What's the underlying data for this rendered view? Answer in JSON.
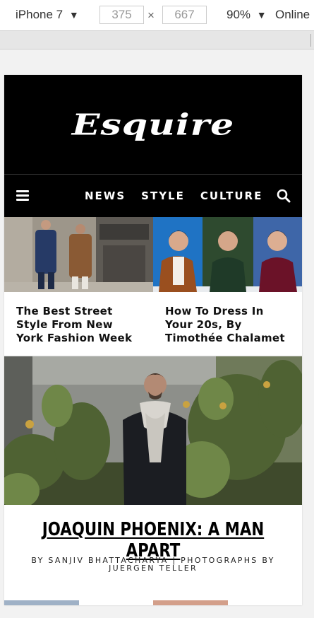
{
  "devtools": {
    "device": "iPhone 7",
    "width": "375",
    "height": "667",
    "times": "×",
    "zoom": "90%",
    "network": "Online",
    "caret": "▼"
  },
  "site": {
    "logo": "Esquire",
    "nav": [
      "NEWS",
      "STYLE",
      "CULTURE"
    ]
  },
  "cards": [
    {
      "title": "The Best Street Style From New York Fashion Week"
    },
    {
      "title": "How To Dress In Your 20s, By Timothée Chalamet"
    }
  ],
  "feature": {
    "title": "JOAQUIN PHOENIX: A MAN APART",
    "byline": "BY SANJIV BHATTACHARYA | PHOTOGRAPHS BY JUERGEN TELLER"
  },
  "colors": {
    "masthead": "#000000",
    "text": "#111111"
  }
}
